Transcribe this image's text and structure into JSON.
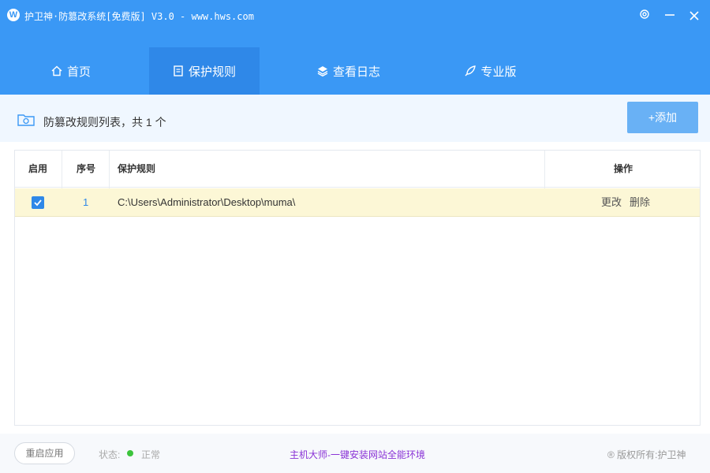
{
  "window": {
    "title": "护卫神·防篡改系统[免费版] V3.0 - www.hws.com",
    "logo_letter": "W"
  },
  "nav": {
    "tabs": [
      {
        "label": "首页",
        "icon": "home-icon",
        "active": false
      },
      {
        "label": "保护规则",
        "icon": "document-icon",
        "active": true
      },
      {
        "label": "查看日志",
        "icon": "layers-icon",
        "active": false
      },
      {
        "label": "专业版",
        "icon": "rocket-icon",
        "active": false
      }
    ]
  },
  "list": {
    "title": "防篡改规则列表，共 1 个",
    "add_button": "+添加"
  },
  "table": {
    "headers": {
      "enabled": "启用",
      "index": "序号",
      "rule": "保护规则",
      "actions": "操作"
    },
    "rows": [
      {
        "enabled": true,
        "index": "1",
        "path": "C:\\Users\\Administrator\\Desktop\\muma\\",
        "edit": "更改",
        "delete": "删除"
      }
    ]
  },
  "footer": {
    "restart_button": "重启应用",
    "status_label": "状态:",
    "status_value": "正常",
    "promo_link": "主机大师-一键安装网站全能环境",
    "copyright": "® 版权所有:护卫神"
  },
  "colors": {
    "primary": "#3a98f5",
    "active_tab": "#2f88e8",
    "row_highlight": "#fcf7d6",
    "status_ok": "#3cc43c",
    "promo": "#8a33d6"
  }
}
